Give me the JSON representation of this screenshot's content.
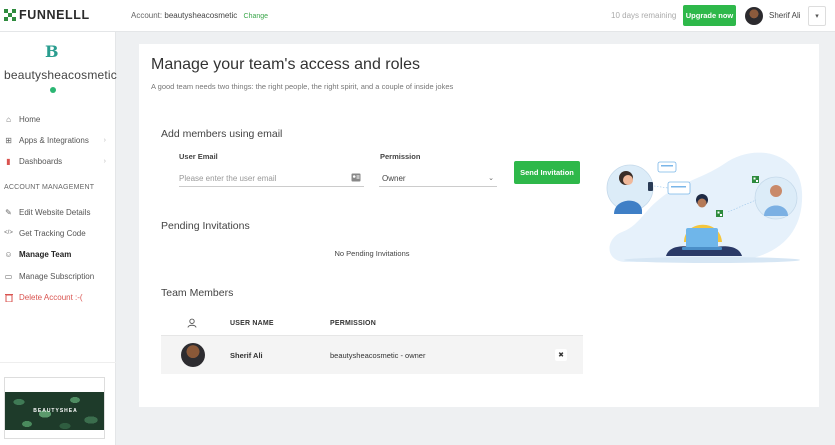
{
  "topbar": {
    "logo_text": "FUNNELLL",
    "account_label": "Account:",
    "account_name": "beautysheacosmetic",
    "change_label": "Change",
    "trial_text": "10 days remaining",
    "upgrade_label": "Upgrade now",
    "user_name": "Sherif Ali",
    "caret": "▾"
  },
  "sidebar": {
    "brand_glyph": "B",
    "site_name": "beautysheacosmetic",
    "items_top": [
      {
        "label": "Home",
        "icon": "home-icon",
        "glyph": "⌂",
        "arrow": ""
      },
      {
        "label": "Apps & Integrations",
        "icon": "grid-icon",
        "glyph": "⊞",
        "arrow": "›"
      },
      {
        "label": "Dashboards",
        "icon": "bar-chart-icon",
        "glyph": "▮",
        "arrow": "›"
      }
    ],
    "section_label": "ACCOUNT MANAGEMENT",
    "items_account": [
      {
        "label": "Edit Website Details",
        "icon": "pencil-icon",
        "glyph": "✎"
      },
      {
        "label": "Get Tracking Code",
        "icon": "code-icon",
        "glyph": "</>"
      },
      {
        "label": "Manage Team",
        "icon": "team-icon",
        "glyph": "☺"
      },
      {
        "label": "Manage Subscription",
        "icon": "card-icon",
        "glyph": "▭"
      },
      {
        "label": "Delete Account :-(",
        "icon": "trash-icon",
        "glyph": "🗑"
      }
    ],
    "preview_brand": "BEAUTYSHEA"
  },
  "main": {
    "title": "Manage your team's access and roles",
    "subtitle": "A good team needs two things: the right people, the right spirit, and a couple of inside jokes",
    "add_heading": "Add members using email",
    "email_label": "User Email",
    "email_placeholder": "Please enter the user email",
    "permission_label": "Permission",
    "permission_value": "Owner",
    "send_label": "Send Invitation",
    "pending_heading": "Pending Invitations",
    "no_pending": "No Pending Invitations",
    "team_heading": "Team Members",
    "columns": {
      "user_name": "USER NAME",
      "permission": "PERMISSION"
    },
    "members": [
      {
        "name": "Sherif Ali",
        "permission": "beautysheacosmetic - owner"
      }
    ],
    "remove_glyph": "✖"
  },
  "colors": {
    "accent_green": "#2eb84a",
    "danger": "#d9534f",
    "logo_green": "#2e8b3d"
  }
}
